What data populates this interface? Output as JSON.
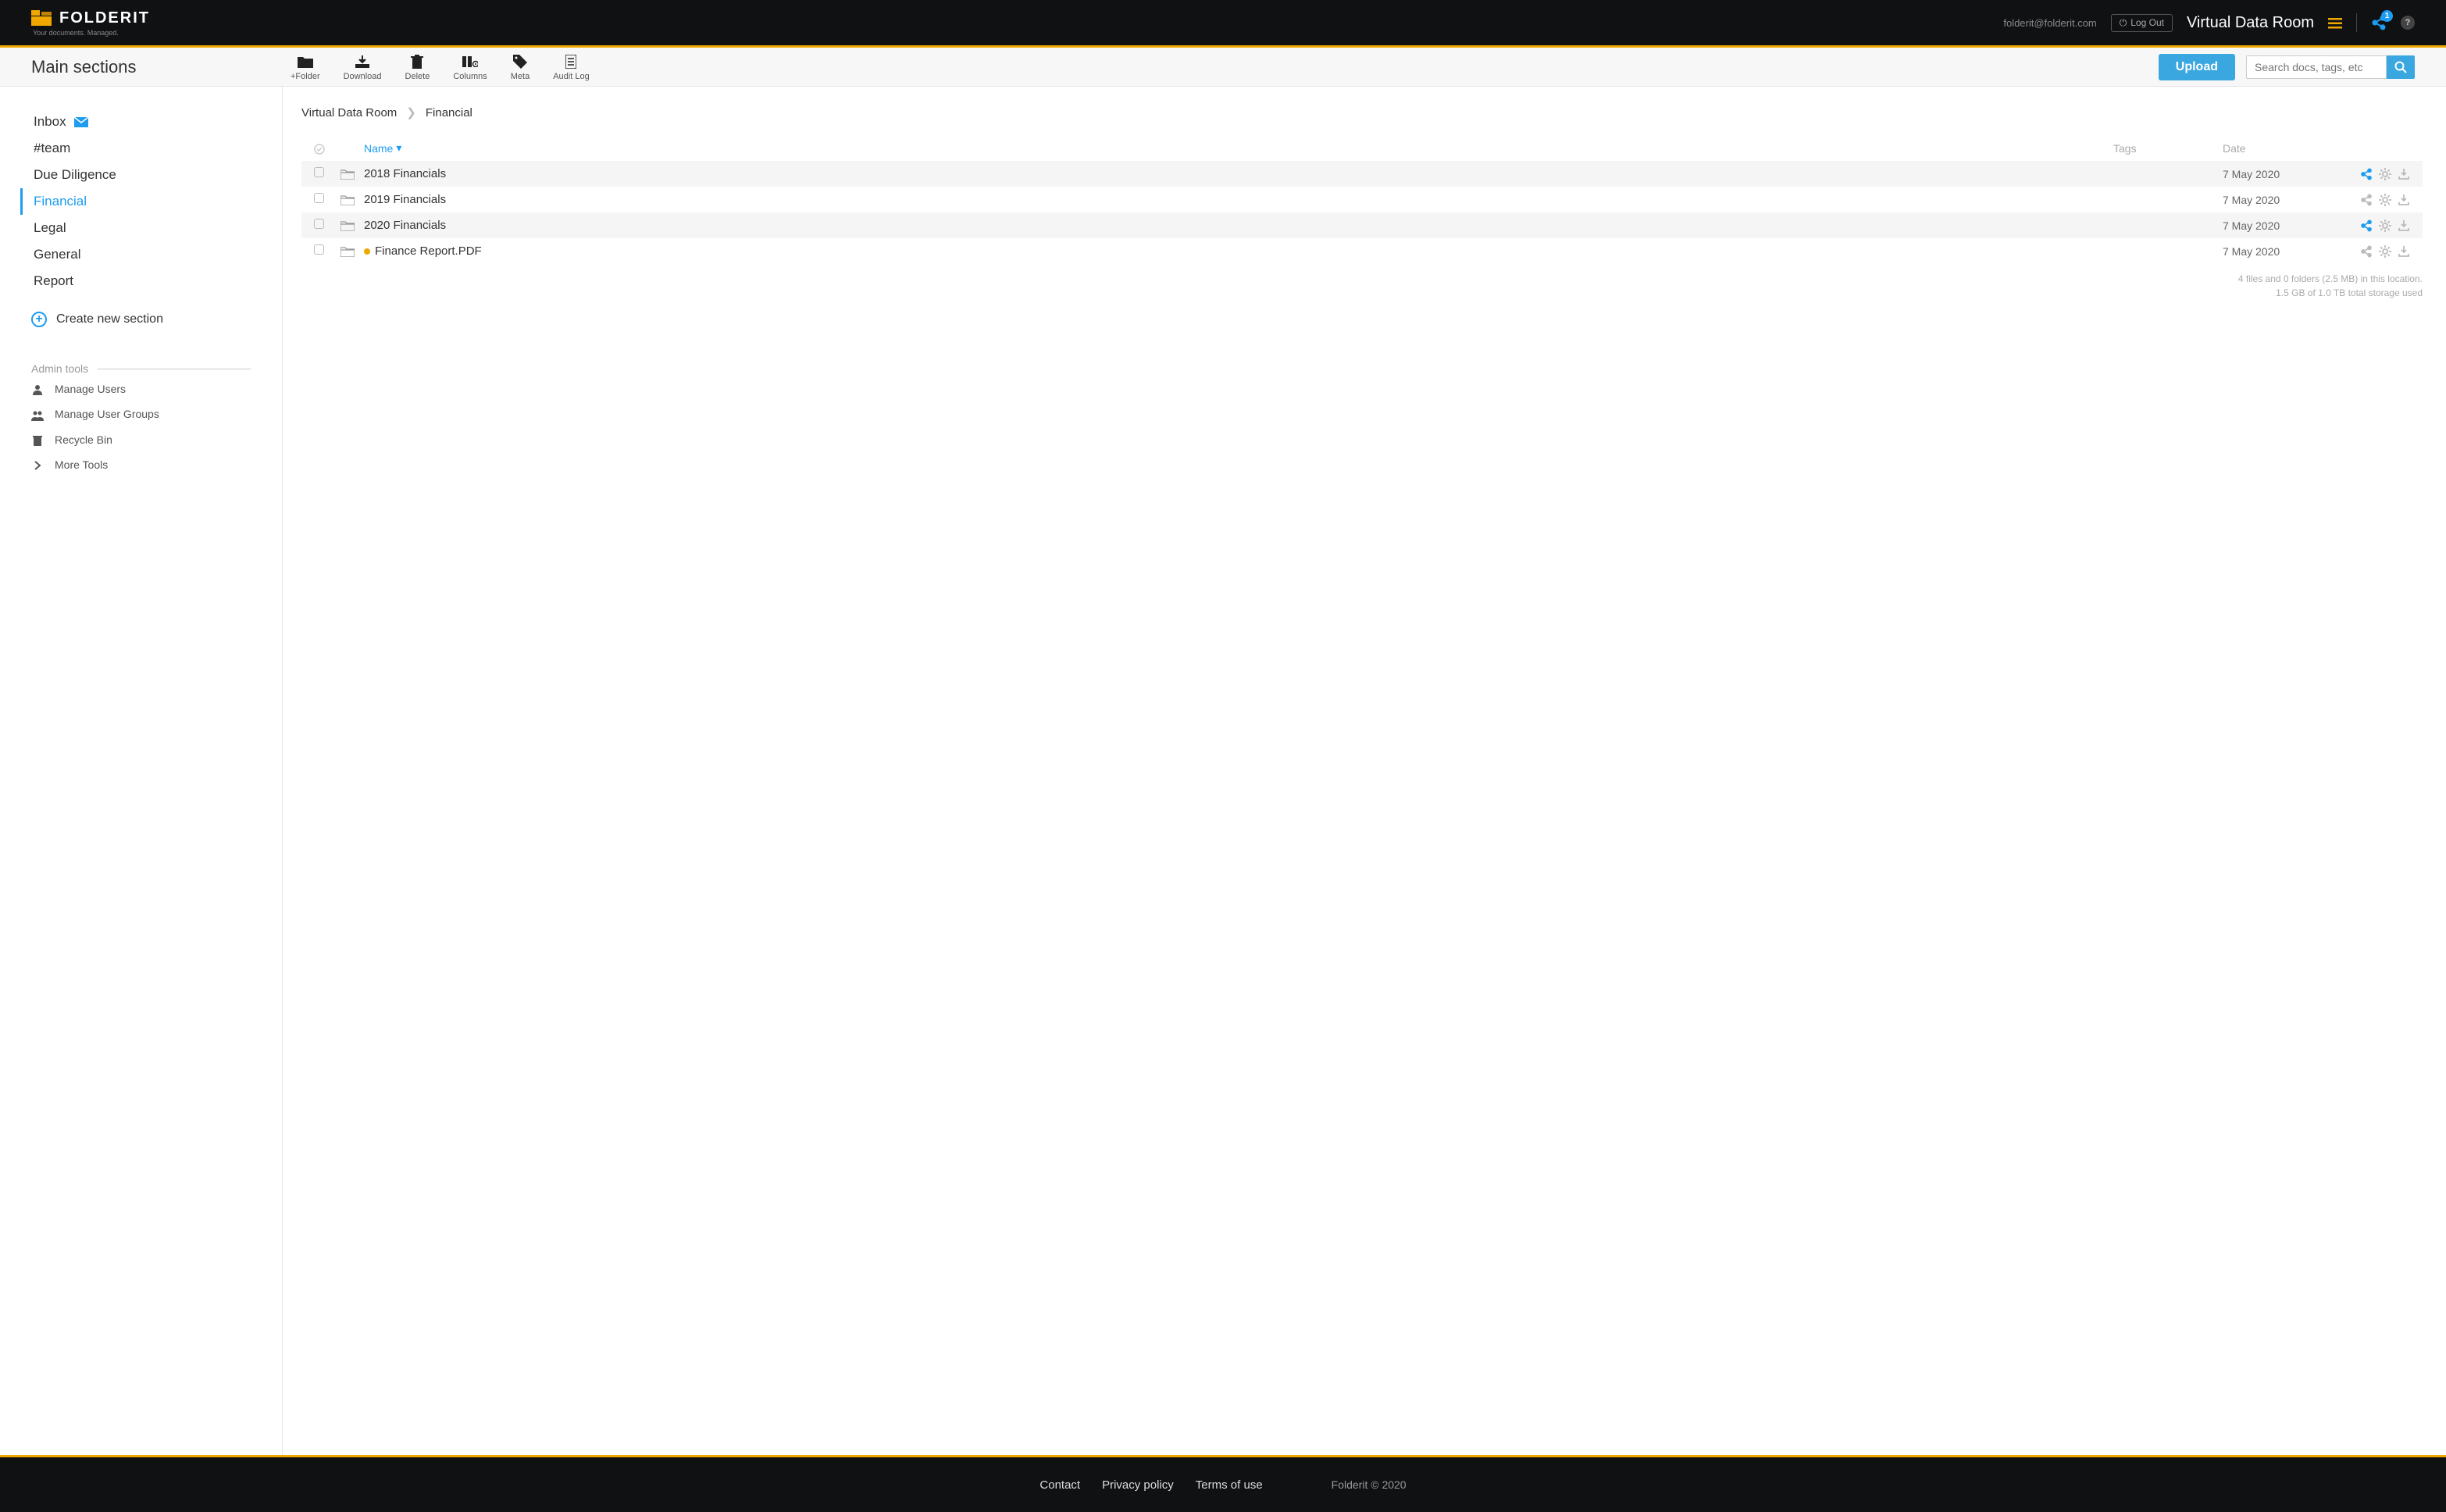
{
  "header": {
    "brand": "FOLDERIT",
    "tagline": "Your documents. Managed.",
    "email": "folderit@folderit.com",
    "logout": "Log Out",
    "room_title": "Virtual Data Room",
    "share_badge": "1",
    "help": "?"
  },
  "toolbar": {
    "page_title": "Main sections",
    "buttons": {
      "folder": "+Folder",
      "download": "Download",
      "delete": "Delete",
      "columns": "Columns",
      "meta": "Meta",
      "audit": "Audit Log"
    },
    "upload": "Upload",
    "search_placeholder": "Search docs, tags, etc"
  },
  "sidebar": {
    "items": [
      {
        "label": "Inbox",
        "icon": "mail",
        "active": false
      },
      {
        "label": "#team",
        "icon": "",
        "active": false
      },
      {
        "label": "Due Diligence",
        "icon": "",
        "active": false
      },
      {
        "label": "Financial",
        "icon": "",
        "active": true
      },
      {
        "label": "Legal",
        "icon": "",
        "active": false
      },
      {
        "label": "General",
        "icon": "",
        "active": false
      },
      {
        "label": "Report",
        "icon": "",
        "active": false
      }
    ],
    "create": "Create new section",
    "admin_header": "Admin tools",
    "admin_items": [
      {
        "label": "Manage Users",
        "icon": "user"
      },
      {
        "label": "Manage User Groups",
        "icon": "users"
      },
      {
        "label": "Recycle Bin",
        "icon": "trash"
      },
      {
        "label": "More Tools",
        "icon": "chevron"
      }
    ]
  },
  "breadcrumb": {
    "root": "Virtual Data Room",
    "current": "Financial"
  },
  "table": {
    "columns": {
      "name": "Name",
      "tags": "Tags",
      "date": "Date"
    },
    "rows": [
      {
        "name": "2018 Financials",
        "date": "7 May 2020",
        "dot": false,
        "share_blue": true
      },
      {
        "name": "2019 Financials",
        "date": "7 May 2020",
        "dot": false,
        "share_blue": false
      },
      {
        "name": "2020 Financials",
        "date": "7 May 2020",
        "dot": false,
        "share_blue": true
      },
      {
        "name": "Finance Report.PDF",
        "date": "7 May 2020",
        "dot": true,
        "share_blue": false
      }
    ]
  },
  "storage": {
    "line1": "4 files and 0 folders (2.5 MB) in this location.",
    "line2": "1.5 GB of 1.0 TB total storage used"
  },
  "footer": {
    "contact": "Contact",
    "privacy": "Privacy policy",
    "terms": "Terms of use",
    "copyright": "Folderit © 2020"
  }
}
